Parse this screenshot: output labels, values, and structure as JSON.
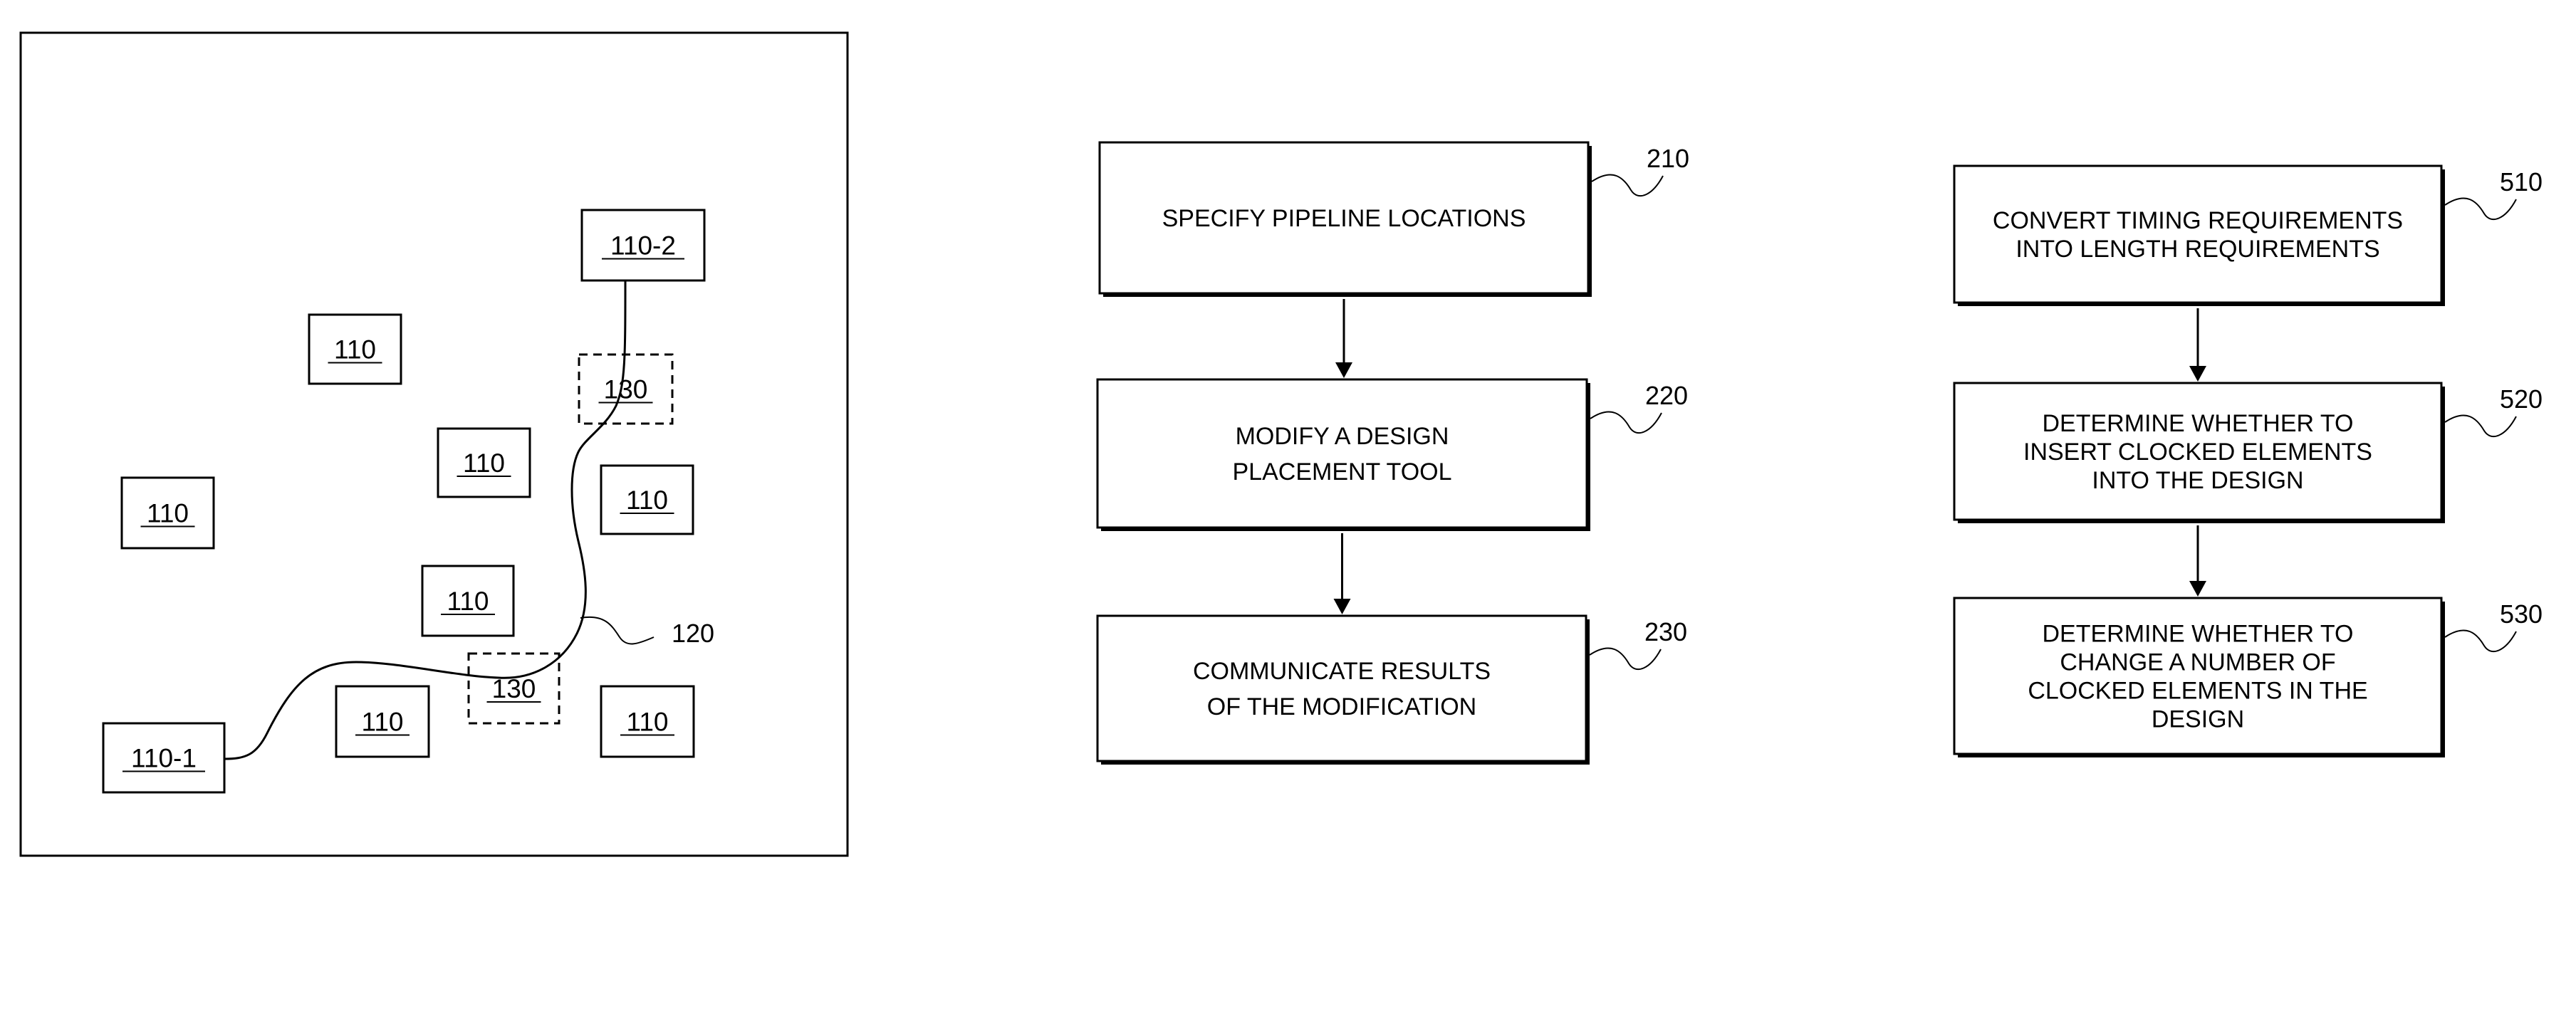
{
  "figure_left": {
    "blocks": [
      {
        "label": "110-2",
        "dashed": false
      },
      {
        "label": "110",
        "dashed": false
      },
      {
        "label": "130",
        "dashed": true
      },
      {
        "label": "110",
        "dashed": false
      },
      {
        "label": "110",
        "dashed": false
      },
      {
        "label": "110",
        "dashed": false
      },
      {
        "label": "110",
        "dashed": false
      },
      {
        "label": "130",
        "dashed": true
      },
      {
        "label": "110",
        "dashed": false
      },
      {
        "label": "110",
        "dashed": false
      },
      {
        "label": "110-1",
        "dashed": false
      }
    ],
    "wire_label": "120"
  },
  "flow_middle": {
    "steps": [
      {
        "ref": "210",
        "lines": [
          "SPECIFY PIPELINE LOCATIONS"
        ]
      },
      {
        "ref": "220",
        "lines": [
          "MODIFY A DESIGN",
          "PLACEMENT TOOL"
        ]
      },
      {
        "ref": "230",
        "lines": [
          "COMMUNICATE RESULTS",
          "OF THE MODIFICATION"
        ]
      }
    ]
  },
  "flow_right": {
    "steps": [
      {
        "ref": "510",
        "lines": [
          "CONVERT TIMING REQUIREMENTS",
          "INTO LENGTH REQUIREMENTS"
        ]
      },
      {
        "ref": "520",
        "lines": [
          "DETERMINE WHETHER TO",
          "INSERT CLOCKED ELEMENTS",
          "INTO THE DESIGN"
        ]
      },
      {
        "ref": "530",
        "lines": [
          "DETERMINE WHETHER TO",
          "CHANGE A NUMBER OF",
          "CLOCKED ELEMENTS IN THE",
          "DESIGN"
        ]
      }
    ]
  }
}
